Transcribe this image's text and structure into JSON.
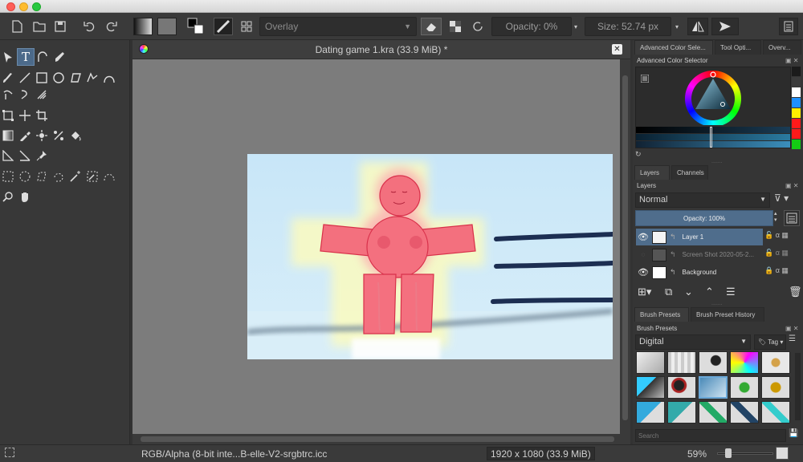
{
  "toolbar": {
    "blend_mode": "Overlay",
    "opacity_label": "Opacity: 0%",
    "size_label": "Size: 52.74 px"
  },
  "document": {
    "title": "Dating game 1.kra (33.9 MiB) *"
  },
  "status": {
    "color_profile": "RGB/Alpha (8-bit inte...B-elle-V2-srgbtrc.icc",
    "image_size": "1920 x 1080 (33.9 MiB)",
    "zoom": "59%"
  },
  "right_panel": {
    "top_tabs": [
      "Advanced Color Sele...",
      "Tool Opti...",
      "Overv..."
    ],
    "color_selector_title": "Advanced Color Selector",
    "layer_tabs": [
      "Layers",
      "Channels"
    ],
    "layers_title": "Layers",
    "blend_mode": "Normal",
    "opacity_label": "Opacity:  100%",
    "layers": [
      {
        "name": "Layer 1",
        "visible": true,
        "selected": true
      },
      {
        "name": "Screen Shot 2020-05-2...",
        "visible": false,
        "selected": false
      },
      {
        "name": "Background",
        "visible": true,
        "selected": false
      }
    ],
    "brush_tabs": [
      "Brush Presets",
      "Brush Preset History"
    ],
    "brush_presets_title": "Brush Presets",
    "brush_tag": "Digital",
    "tag_label": "Tag",
    "search_placeholder": "Search"
  },
  "colors": {
    "palette_swatches": [
      "#1b1b1b",
      "#3c3c3c",
      "#ffffff",
      "#1e90ff",
      "#ffee00",
      "#ff1a1a",
      "#ff1a1a",
      "#14cc14"
    ]
  }
}
